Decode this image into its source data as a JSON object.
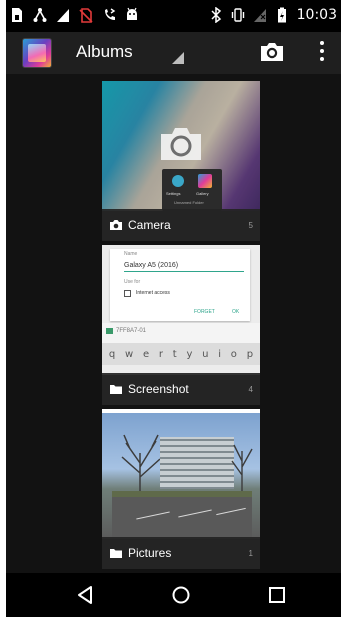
{
  "status_bar": {
    "time": "10:03",
    "left_icons": [
      "sim-card-icon",
      "usb-debug-icon",
      "signal-icon",
      "no-sim-icon",
      "call-forward-icon",
      "android-icon"
    ],
    "right_icons": [
      "bluetooth-icon",
      "vibrate-icon",
      "no-signal-icon",
      "battery-icon"
    ]
  },
  "action_bar": {
    "title": "Albums",
    "app_icon": "gallery-app-icon",
    "actions": [
      "camera-icon",
      "overflow-menu-icon"
    ]
  },
  "albums": [
    {
      "name": "Camera",
      "count": "5",
      "icon": "camera-icon",
      "thumbnail": {
        "popup_left": "Settings",
        "popup_right": "Gallery",
        "popup_caption": "Unnamed Folder"
      }
    },
    {
      "name": "Screenshot",
      "count": "4",
      "icon": "folder-icon",
      "thumbnail": {
        "name_label": "Name",
        "name_value": "Galaxy A5 (2016)",
        "use_for_label": "Use for",
        "checkbox_label": "Internet access",
        "forget_label": "FORGET",
        "ok_label": "OK",
        "wifi_id": "7FF8A7-01",
        "keys": [
          "q",
          "w",
          "e",
          "r",
          "t",
          "y",
          "u",
          "i",
          "o",
          "p"
        ]
      }
    },
    {
      "name": "Pictures",
      "count": "1",
      "icon": "folder-icon"
    }
  ],
  "nav_bar": {
    "buttons": [
      "back-icon",
      "home-icon",
      "recents-icon"
    ]
  },
  "colors": {
    "background": "#121212",
    "action_bar": "#1f1f1f",
    "accent": "#2fa58c"
  }
}
